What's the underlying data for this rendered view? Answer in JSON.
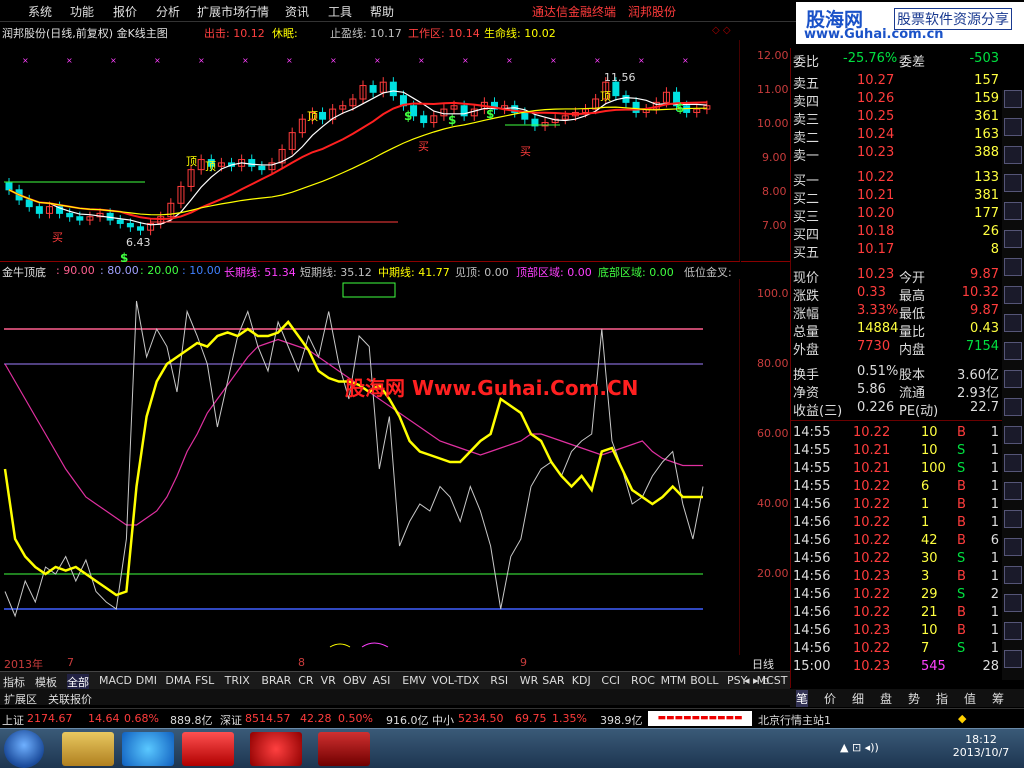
{
  "menu": {
    "items": [
      "系统",
      "功能",
      "报价",
      "分析",
      "扩展市场行情",
      "资讯",
      "工具",
      "帮助"
    ],
    "terminal_link": "通达信金融终端",
    "broker_link": "润邦股份"
  },
  "logo": {
    "name": "股海网",
    "subtitle": "股票软件资源分享",
    "url": "www.Guhai.com.cn"
  },
  "chart_title": {
    "name": "润邦股份(日线,前复权) 金K线主图",
    "exit_label": "出击: 10.12",
    "rest_label": "休眠:",
    "stop_label": "止盈线: 10.17",
    "work_label": "工作区: 10.14",
    "life_label": "生命线: 10.02"
  },
  "colors": {
    "up": "#ff3c3c",
    "down": "#00e0e0",
    "yellow": "#ffff00",
    "red_line": "#ff2020",
    "magenta": "#ff40ff",
    "white": "#ffffff",
    "green": "#40ff40"
  },
  "price_axis": [
    "12.00",
    "11.00",
    "10.00",
    "9.00",
    "8.00",
    "7.00"
  ],
  "price_annotations": {
    "high": "11.56",
    "low": "6.43",
    "top_marker": "顶",
    "buy_marker": "买",
    "sell_marker": "$"
  },
  "indicator": {
    "name": "金牛顶底",
    "params": [
      ": 90.00",
      ": 80.00",
      ": 20.00",
      ": 10.00"
    ],
    "long_line": "长期线: 51.34",
    "short_line": "短期线: 35.12",
    "mid_line": "中期线: 41.77",
    "top_signal": "见顶: 0.00",
    "top_zone": "顶部区域: 0.00",
    "bottom_zone": "底部区域: 0.00",
    "low_golden": "低位金叉:",
    "axis": [
      "100.0",
      "80.00",
      "60.00",
      "40.00",
      "20.00"
    ]
  },
  "watermark": "股海网 Www.Guhai.Com.CN",
  "x_axis": {
    "year": "2013年",
    "months": [
      "7",
      "8",
      "9"
    ],
    "period": "日线"
  },
  "tabs": [
    "指标",
    "模板",
    "全部",
    "MACD",
    "DMI",
    "DMA",
    "FSL",
    "TRIX",
    "BRAR",
    "CR",
    "VR",
    "OBV",
    "ASI",
    "EMV",
    "VOL-TDX",
    "RSI",
    "WR",
    "SAR",
    "KDJ",
    "CCI",
    "ROC",
    "MTM",
    "BOLL",
    "PSY",
    "MCST"
  ],
  "tabs2": [
    "扩展区",
    "关联报价"
  ],
  "quote": {
    "ratio": {
      "label": "委比",
      "value": "-25.76%",
      "diff_label": "委差",
      "diff": "-503"
    },
    "asks": [
      {
        "label": "卖五",
        "price": "10.27",
        "vol": "157"
      },
      {
        "label": "卖四",
        "price": "10.26",
        "vol": "159"
      },
      {
        "label": "卖三",
        "price": "10.25",
        "vol": "361"
      },
      {
        "label": "卖二",
        "price": "10.24",
        "vol": "163"
      },
      {
        "label": "卖一",
        "price": "10.23",
        "vol": "388"
      }
    ],
    "bids": [
      {
        "label": "买一",
        "price": "10.22",
        "vol": "133"
      },
      {
        "label": "买二",
        "price": "10.21",
        "vol": "381"
      },
      {
        "label": "买三",
        "price": "10.20",
        "vol": "177"
      },
      {
        "label": "买四",
        "price": "10.18",
        "vol": "26"
      },
      {
        "label": "买五",
        "price": "10.17",
        "vol": "8"
      }
    ],
    "stats": [
      {
        "l1": "现价",
        "v1": "10.23",
        "l2": "今开",
        "v2": "9.87"
      },
      {
        "l1": "涨跌",
        "v1": "0.33",
        "l2": "最高",
        "v2": "10.32"
      },
      {
        "l1": "涨幅",
        "v1": "3.33%",
        "l2": "最低",
        "v2": "9.87"
      },
      {
        "l1": "总量",
        "v1": "14884",
        "l2": "量比",
        "v2": "0.43"
      },
      {
        "l1": "外盘",
        "v1": "7730",
        "l2": "内盘",
        "v2": "7154"
      }
    ],
    "stats2": [
      {
        "l1": "换手",
        "v1": "0.51%",
        "l2": "股本",
        "v2": "3.60亿"
      },
      {
        "l1": "净资",
        "v1": "5.86",
        "l2": "流通",
        "v2": "2.93亿"
      },
      {
        "l1": "收益(三)",
        "v1": "0.226",
        "l2": "PE(动)",
        "v2": "22.7"
      }
    ],
    "ticks": [
      {
        "t": "14:55",
        "p": "10.22",
        "v": "10",
        "d": "B",
        "n": "1"
      },
      {
        "t": "14:55",
        "p": "10.21",
        "v": "10",
        "d": "S",
        "n": "1"
      },
      {
        "t": "14:55",
        "p": "10.21",
        "v": "100",
        "d": "S",
        "n": "1"
      },
      {
        "t": "14:55",
        "p": "10.22",
        "v": "6",
        "d": "B",
        "n": "1"
      },
      {
        "t": "14:56",
        "p": "10.22",
        "v": "1",
        "d": "B",
        "n": "1"
      },
      {
        "t": "14:56",
        "p": "10.22",
        "v": "1",
        "d": "B",
        "n": "1"
      },
      {
        "t": "14:56",
        "p": "10.22",
        "v": "42",
        "d": "B",
        "n": "6"
      },
      {
        "t": "14:56",
        "p": "10.22",
        "v": "30",
        "d": "S",
        "n": "1"
      },
      {
        "t": "14:56",
        "p": "10.23",
        "v": "3",
        "d": "B",
        "n": "1"
      },
      {
        "t": "14:56",
        "p": "10.22",
        "v": "29",
        "d": "S",
        "n": "2"
      },
      {
        "t": "14:56",
        "p": "10.22",
        "v": "21",
        "d": "B",
        "n": "1"
      },
      {
        "t": "14:56",
        "p": "10.23",
        "v": "10",
        "d": "B",
        "n": "1"
      },
      {
        "t": "14:56",
        "p": "10.22",
        "v": "7",
        "d": "S",
        "n": "1"
      },
      {
        "t": "15:00",
        "p": "10.23",
        "v": "545",
        "d": "",
        "n": "28"
      }
    ],
    "tabs": [
      "笔",
      "价",
      "细",
      "盘",
      "势",
      "指",
      "值",
      "筹"
    ]
  },
  "status": {
    "sh_label": "上证",
    "sh_val": "2174.67",
    "sh_chg": "14.64",
    "sh_pct": "0.68%",
    "sh_amt": "889.8亿",
    "sz_label": "深证",
    "sz_val": "8514.57",
    "sz_chg": "42.28",
    "sz_pct": "0.50%",
    "sz_amt": "916.0亿",
    "zx_label": "中小",
    "zx_val": "5234.50",
    "zx_chg": "69.75",
    "zx_pct": "1.35%",
    "zx_amt": "398.9亿",
    "server": "北京行情主站1"
  },
  "clock": {
    "time": "18:12",
    "date": "2013/10/7"
  },
  "chart_data": {
    "type": "line",
    "x": [
      "7",
      "8",
      "9"
    ],
    "series": [
      {
        "name": "长期线",
        "values": [
          51.34
        ]
      },
      {
        "name": "短期线",
        "values": [
          35.12
        ]
      },
      {
        "name": "中期线",
        "values": [
          41.77
        ]
      }
    ],
    "ylim": [
      0,
      100
    ]
  }
}
